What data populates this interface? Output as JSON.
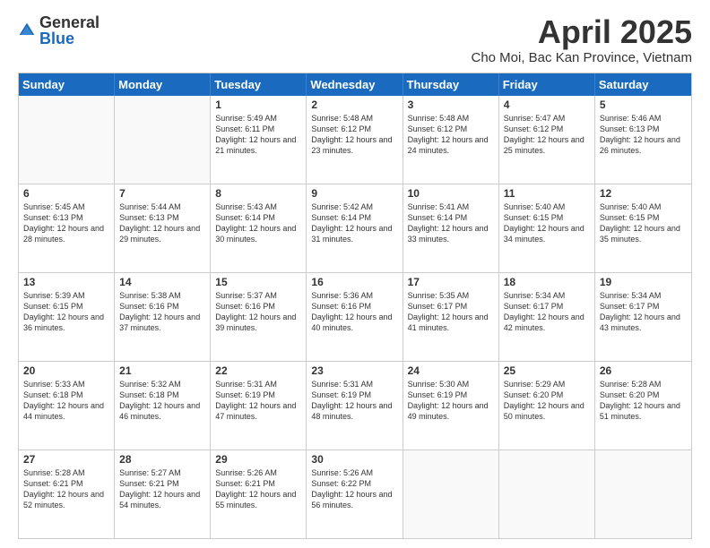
{
  "logo": {
    "general": "General",
    "blue": "Blue"
  },
  "title": "April 2025",
  "location": "Cho Moi, Bac Kan Province, Vietnam",
  "days": [
    "Sunday",
    "Monday",
    "Tuesday",
    "Wednesday",
    "Thursday",
    "Friday",
    "Saturday"
  ],
  "weeks": [
    [
      {
        "day": "",
        "info": ""
      },
      {
        "day": "",
        "info": ""
      },
      {
        "day": "1",
        "info": "Sunrise: 5:49 AM\nSunset: 6:11 PM\nDaylight: 12 hours and 21 minutes."
      },
      {
        "day": "2",
        "info": "Sunrise: 5:48 AM\nSunset: 6:12 PM\nDaylight: 12 hours and 23 minutes."
      },
      {
        "day": "3",
        "info": "Sunrise: 5:48 AM\nSunset: 6:12 PM\nDaylight: 12 hours and 24 minutes."
      },
      {
        "day": "4",
        "info": "Sunrise: 5:47 AM\nSunset: 6:12 PM\nDaylight: 12 hours and 25 minutes."
      },
      {
        "day": "5",
        "info": "Sunrise: 5:46 AM\nSunset: 6:13 PM\nDaylight: 12 hours and 26 minutes."
      }
    ],
    [
      {
        "day": "6",
        "info": "Sunrise: 5:45 AM\nSunset: 6:13 PM\nDaylight: 12 hours and 28 minutes."
      },
      {
        "day": "7",
        "info": "Sunrise: 5:44 AM\nSunset: 6:13 PM\nDaylight: 12 hours and 29 minutes."
      },
      {
        "day": "8",
        "info": "Sunrise: 5:43 AM\nSunset: 6:14 PM\nDaylight: 12 hours and 30 minutes."
      },
      {
        "day": "9",
        "info": "Sunrise: 5:42 AM\nSunset: 6:14 PM\nDaylight: 12 hours and 31 minutes."
      },
      {
        "day": "10",
        "info": "Sunrise: 5:41 AM\nSunset: 6:14 PM\nDaylight: 12 hours and 33 minutes."
      },
      {
        "day": "11",
        "info": "Sunrise: 5:40 AM\nSunset: 6:15 PM\nDaylight: 12 hours and 34 minutes."
      },
      {
        "day": "12",
        "info": "Sunrise: 5:40 AM\nSunset: 6:15 PM\nDaylight: 12 hours and 35 minutes."
      }
    ],
    [
      {
        "day": "13",
        "info": "Sunrise: 5:39 AM\nSunset: 6:15 PM\nDaylight: 12 hours and 36 minutes."
      },
      {
        "day": "14",
        "info": "Sunrise: 5:38 AM\nSunset: 6:16 PM\nDaylight: 12 hours and 37 minutes."
      },
      {
        "day": "15",
        "info": "Sunrise: 5:37 AM\nSunset: 6:16 PM\nDaylight: 12 hours and 39 minutes."
      },
      {
        "day": "16",
        "info": "Sunrise: 5:36 AM\nSunset: 6:16 PM\nDaylight: 12 hours and 40 minutes."
      },
      {
        "day": "17",
        "info": "Sunrise: 5:35 AM\nSunset: 6:17 PM\nDaylight: 12 hours and 41 minutes."
      },
      {
        "day": "18",
        "info": "Sunrise: 5:34 AM\nSunset: 6:17 PM\nDaylight: 12 hours and 42 minutes."
      },
      {
        "day": "19",
        "info": "Sunrise: 5:34 AM\nSunset: 6:17 PM\nDaylight: 12 hours and 43 minutes."
      }
    ],
    [
      {
        "day": "20",
        "info": "Sunrise: 5:33 AM\nSunset: 6:18 PM\nDaylight: 12 hours and 44 minutes."
      },
      {
        "day": "21",
        "info": "Sunrise: 5:32 AM\nSunset: 6:18 PM\nDaylight: 12 hours and 46 minutes."
      },
      {
        "day": "22",
        "info": "Sunrise: 5:31 AM\nSunset: 6:19 PM\nDaylight: 12 hours and 47 minutes."
      },
      {
        "day": "23",
        "info": "Sunrise: 5:31 AM\nSunset: 6:19 PM\nDaylight: 12 hours and 48 minutes."
      },
      {
        "day": "24",
        "info": "Sunrise: 5:30 AM\nSunset: 6:19 PM\nDaylight: 12 hours and 49 minutes."
      },
      {
        "day": "25",
        "info": "Sunrise: 5:29 AM\nSunset: 6:20 PM\nDaylight: 12 hours and 50 minutes."
      },
      {
        "day": "26",
        "info": "Sunrise: 5:28 AM\nSunset: 6:20 PM\nDaylight: 12 hours and 51 minutes."
      }
    ],
    [
      {
        "day": "27",
        "info": "Sunrise: 5:28 AM\nSunset: 6:21 PM\nDaylight: 12 hours and 52 minutes."
      },
      {
        "day": "28",
        "info": "Sunrise: 5:27 AM\nSunset: 6:21 PM\nDaylight: 12 hours and 54 minutes."
      },
      {
        "day": "29",
        "info": "Sunrise: 5:26 AM\nSunset: 6:21 PM\nDaylight: 12 hours and 55 minutes."
      },
      {
        "day": "30",
        "info": "Sunrise: 5:26 AM\nSunset: 6:22 PM\nDaylight: 12 hours and 56 minutes."
      },
      {
        "day": "",
        "info": ""
      },
      {
        "day": "",
        "info": ""
      },
      {
        "day": "",
        "info": ""
      }
    ]
  ]
}
